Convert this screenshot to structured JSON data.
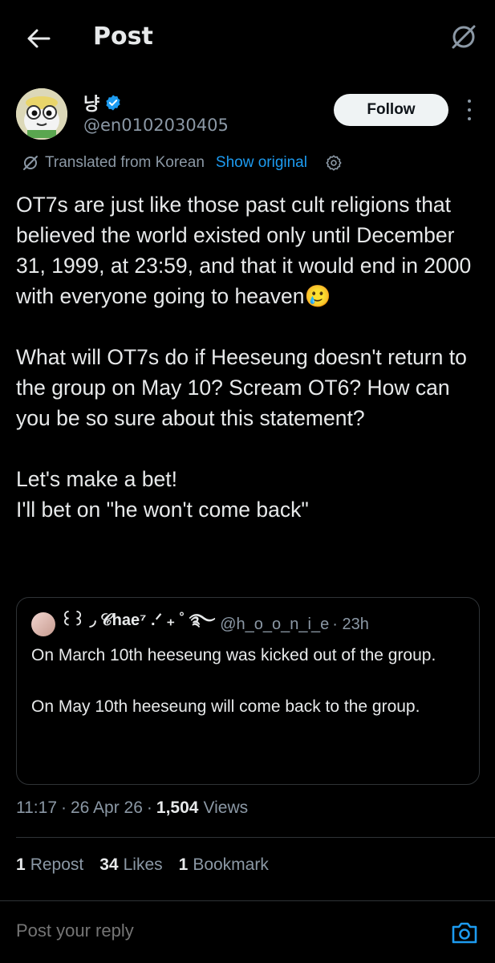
{
  "header": {
    "title": "Post"
  },
  "author": {
    "display_name": "냥",
    "handle": "@en0102030405",
    "follow_label": "Follow"
  },
  "translation": {
    "note": "Translated from Korean",
    "show_original": "Show original"
  },
  "post": {
    "paragraphs": [
      "OT7s are just like those past cult religions that believed the world existed only until December 31, 1999, at 23:59, and that it would end in 2000 with everyone going to heaven🥲",
      "What will OT7s do if Heeseung doesn't return to the group on May 10? Scream OT6? How can you be so sure about this statement?",
      "Let's make a bet!",
      "I'll bet on \"he won't come back\""
    ]
  },
  "quote": {
    "name": "꒰꒱ ◞ 𝒞hae⁷ .ᐟ ₊ ˚ ࿐",
    "handle": "@h_o_o_n_i_e",
    "time": "· 23h",
    "paragraphs": [
      "On March 10th heeseung was kicked out of the group.",
      "On May 10th heeseung will come back to the group."
    ]
  },
  "meta": {
    "time": "11:17",
    "date": "26 Apr 26",
    "views_count": "1,504",
    "views_label": "Views"
  },
  "stats": {
    "reposts_count": "1",
    "reposts_label": "Repost",
    "likes_count": "34",
    "likes_label": "Likes",
    "bookmarks_count": "1",
    "bookmarks_label": "Bookmark"
  },
  "reply": {
    "placeholder": "Post your reply"
  },
  "colors": {
    "accent": "#1d9bf0",
    "muted": "#8b98a5",
    "text": "#e7e9ea",
    "background": "#000000",
    "border": "#2f3336"
  }
}
